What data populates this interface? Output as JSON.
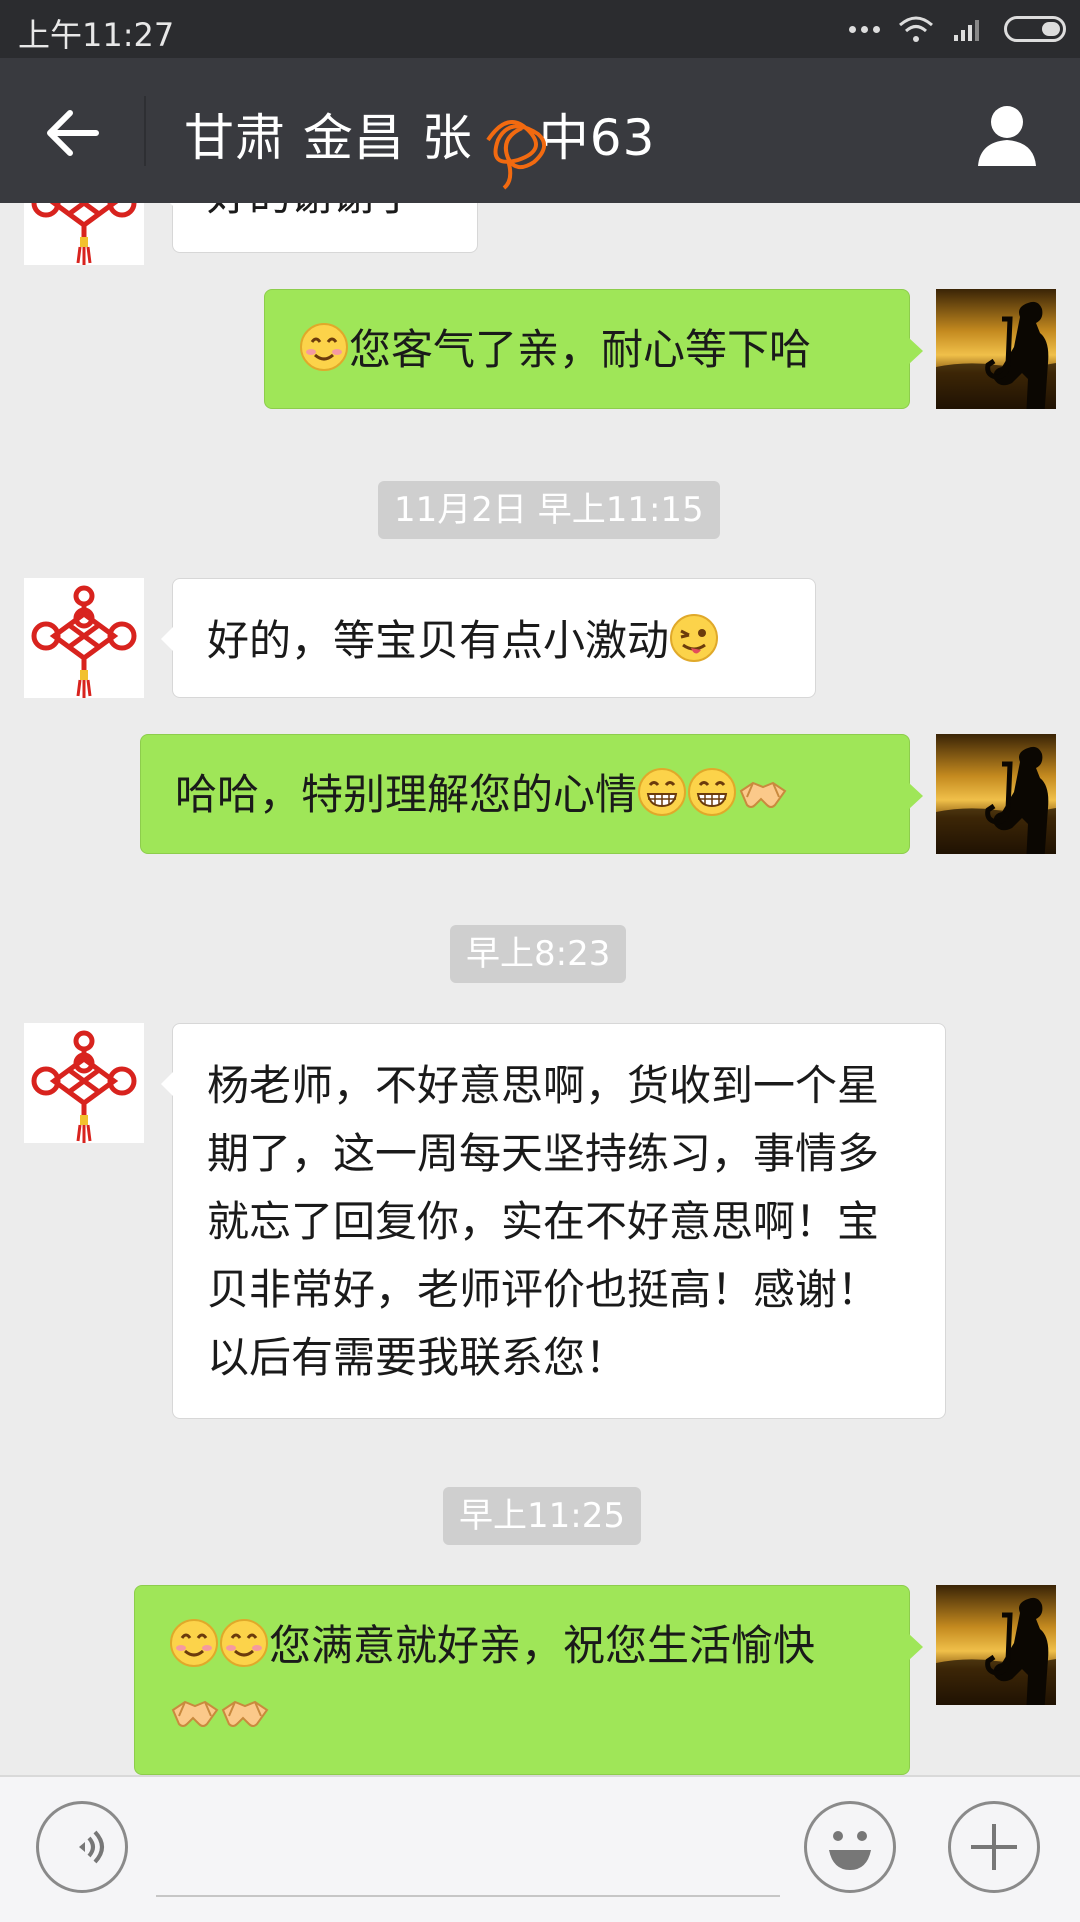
{
  "status_bar": {
    "time": "上午11:27"
  },
  "header": {
    "title_prefix": "甘肃 金昌 张",
    "title_suffix": "中63"
  },
  "messages": [
    {
      "id": "m0",
      "side": "in",
      "text": "好的谢谢了"
    },
    {
      "id": "m1",
      "side": "out",
      "emoji_before": [
        "smile"
      ],
      "text": "您客气了亲，耐心等下哈"
    },
    {
      "id": "t1",
      "type": "timestamp",
      "text": "11月2日 早上11:15"
    },
    {
      "id": "m2",
      "side": "in",
      "text": "好的，等宝贝有点小激动",
      "emoji_after": [
        "wink-tongue"
      ]
    },
    {
      "id": "m3",
      "side": "out",
      "text": "哈哈，特别理解您的心情",
      "emoji_after": [
        "grin",
        "grin",
        "handshake"
      ]
    },
    {
      "id": "t2",
      "type": "timestamp",
      "text": "早上8:23"
    },
    {
      "id": "m4",
      "side": "in",
      "lines": [
        "杨老师，不好意思啊，货收到一个星",
        "期了，这一周每天坚持练习，事情多",
        "就忘了回复你，实在不好意思啊！宝",
        "贝非常好，老师评价也挺高！感谢！",
        "以后有需要我联系您！"
      ]
    },
    {
      "id": "t3",
      "type": "timestamp",
      "text": "早上11:25"
    },
    {
      "id": "m5",
      "side": "out",
      "emoji_before": [
        "smile",
        "smile"
      ],
      "text": "您满意就好亲，祝您生活愉快",
      "emoji_line2": [
        "handshake",
        "handshake"
      ]
    }
  ],
  "colors": {
    "out_bubble": "#9fe658",
    "in_bubble": "#ffffff",
    "title_bar": "#393a3f"
  },
  "icons": {
    "back": "arrow-left-icon",
    "profile": "person-icon",
    "voice": "voice-icon",
    "emoji": "emoji-icon",
    "plus": "plus-icon"
  }
}
